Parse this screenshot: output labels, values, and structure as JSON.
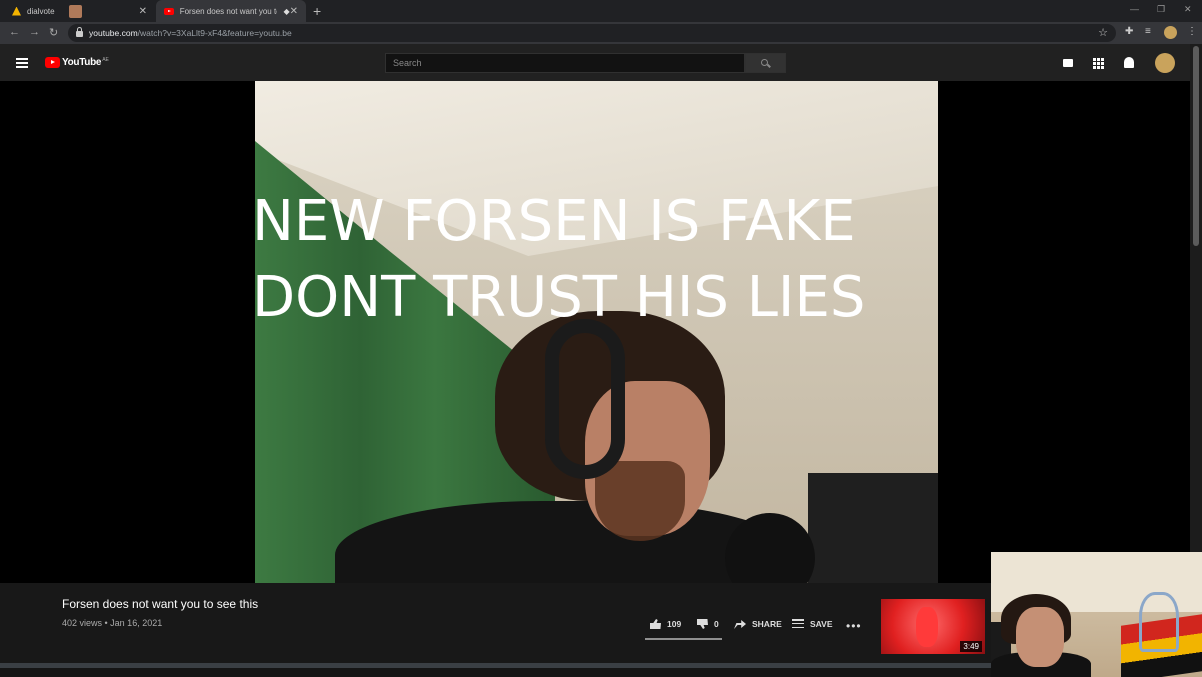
{
  "browser": {
    "tabs": [
      {
        "title": "dialvote",
        "active": false
      },
      {
        "title": "Forsen does not want you to",
        "active": true
      }
    ],
    "new_tab_label": "+",
    "url_host": "youtube.com",
    "url_path": "/watch?v=3XaLlt9-xF4&feature=youtu.be"
  },
  "youtube": {
    "logo_text": "YouTube",
    "country_code": "AE",
    "search_placeholder": "Search"
  },
  "video": {
    "caption_line1": "NEW FORSEN IS FAKE",
    "caption_line2": "DONT TRUST HIS LIES",
    "title": "Forsen does not want you to see this",
    "meta": "402 views • Jan 16, 2021",
    "likes": "109",
    "dislikes": "0",
    "like_ratio": 1.0,
    "share_label": "SHARE",
    "save_label": "SAVE",
    "more_label": "•••"
  },
  "recommended": {
    "duration": "3:49"
  },
  "colors": {
    "yt_red": "#ff0000",
    "page_bg": "#0f0f0f",
    "header_bg": "#212121"
  }
}
